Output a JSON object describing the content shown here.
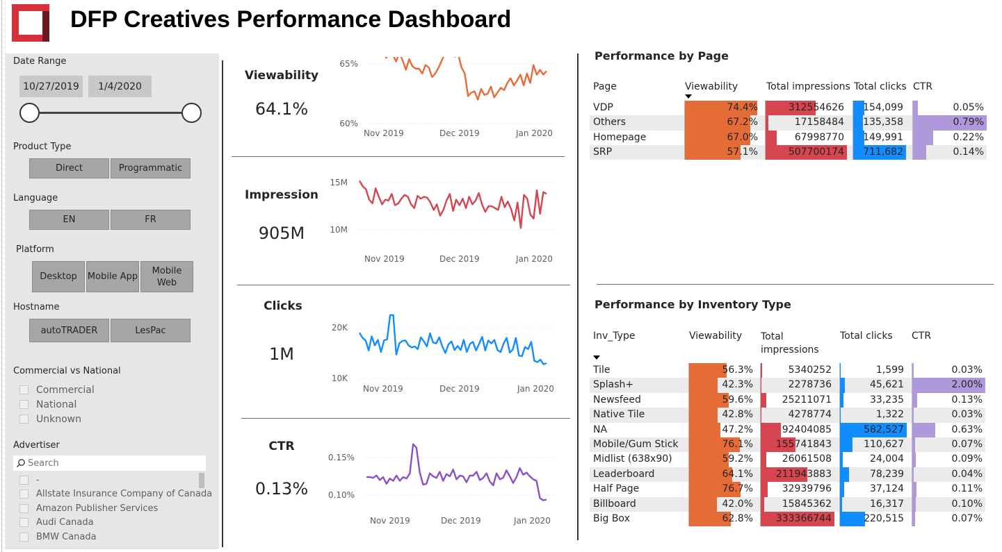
{
  "header": {
    "title": "DFP Creatives Performance Dashboard",
    "logo_icon": "logo-square-icon"
  },
  "colors": {
    "viewability": "#e66c37",
    "impressions": "#d64550",
    "clicks": "#118dff",
    "ctr": "#8a4fc7",
    "ctr_bar": "#b099db",
    "panel": "#e6e6e6",
    "button": "#a6a6a6"
  },
  "filters": {
    "date_range": {
      "label": "Date Range",
      "start": "10/27/2019",
      "end": "1/4/2020"
    },
    "product_type": {
      "label": "Product Type",
      "options": [
        "Direct",
        "Programmatic"
      ]
    },
    "language": {
      "label": "Language",
      "options": [
        "EN",
        "FR"
      ]
    },
    "platform": {
      "label": "Platform",
      "options": [
        "Desktop",
        "Mobile App",
        "Mobile Web"
      ]
    },
    "hostname": {
      "label": "Hostname",
      "options": [
        "autoTRADER",
        "LesPac"
      ]
    },
    "commercial_vs_national": {
      "label": "Commercial vs National",
      "options": [
        "Commercial",
        "National",
        "Unknown"
      ]
    },
    "advertiser": {
      "label": "Advertiser",
      "search_placeholder": "Search",
      "search_icon": "search-icon",
      "options": [
        "-",
        "Allstate Insurance Company of Canada",
        "Amazon Publisher Services",
        "Audi Canada",
        "BMW Canada"
      ]
    }
  },
  "kpis": [
    {
      "title": "Viewability",
      "value": "64.1%",
      "y_ticks": [
        "65%",
        "60%"
      ],
      "x_ticks": [
        "Nov 2019",
        "Dec 2019",
        "Jan 2020"
      ]
    },
    {
      "title": "Impression",
      "value": "905M",
      "y_ticks": [
        "15M",
        "10M"
      ],
      "x_ticks": [
        "Nov 2019",
        "Dec 2019",
        "Jan 2020"
      ]
    },
    {
      "title": "Clicks",
      "value": "1M",
      "y_ticks": [
        "20K",
        "10K"
      ],
      "x_ticks": [
        "Nov 2019",
        "Dec 2019",
        "Jan 2020"
      ]
    },
    {
      "title": "CTR",
      "value": "0.13%",
      "y_ticks": [
        "0.15%",
        "0.10%"
      ],
      "x_ticks": [
        "Nov 2019",
        "Dec 2019",
        "Jan 2020"
      ]
    }
  ],
  "chart_data": [
    {
      "type": "line",
      "x_ticks": [
        "Nov 2019",
        "Dec 2019",
        "Jan 2020"
      ],
      "y_ticks": [
        "60%",
        "65%"
      ],
      "ylim": [
        60,
        65
      ],
      "series": [
        {
          "values": [
            66.8,
            66.0,
            66.0,
            66.5,
            66.0,
            65.5,
            66.3,
            65.8,
            65.2,
            65.9,
            65.3,
            64.5,
            65.4,
            64.8,
            64.6,
            64.6,
            64.2,
            64.9,
            64.7,
            63.9,
            64.2,
            64.7,
            65.3,
            65.9,
            66.0,
            65.8,
            65.6,
            65.8,
            64.7,
            64.2,
            62.3,
            62.6,
            62.7,
            62.0,
            62.9,
            62.4,
            62.5,
            63.1,
            62.2,
            62.6,
            63.0,
            62.8,
            63.4,
            63.8,
            63.2,
            63.6,
            64.1,
            63.2,
            64.2,
            63.4,
            64.9,
            64.1,
            64.5,
            64.1,
            64.4
          ]
        }
      ]
    },
    {
      "type": "line",
      "x_ticks": [
        "Nov 2019",
        "Dec 2019",
        "Jan 2020"
      ],
      "y_ticks": [
        "10M",
        "15M"
      ],
      "ylim": [
        10,
        15
      ],
      "series": [
        {
          "values": [
            15.2,
            14.6,
            14.3,
            13.2,
            12.8,
            14.4,
            13.5,
            12.7,
            13.2,
            13.1,
            13.8,
            12.6,
            12.8,
            13.3,
            13.7,
            13.5,
            12.7,
            12.3,
            13.6,
            13.3,
            13.5,
            13.4,
            12.9,
            12.1,
            12.7,
            11.5,
            12.1,
            13.1,
            13.8,
            12.0,
            13.2,
            12.6,
            13.3,
            12.3,
            13.5,
            12.7,
            13.1,
            13.9,
            12.7,
            11.9,
            12.5,
            12.5,
            12.3,
            12.1,
            13.5,
            12.4,
            13.0,
            12.2,
            11.0,
            12.9,
            10.2,
            13.7,
            13.3,
            11.6,
            11.2,
            14.2,
            11.7,
            14.0,
            13.8
          ]
        }
      ]
    },
    {
      "type": "line",
      "x_ticks": [
        "Nov 2019",
        "Dec 2019",
        "Jan 2020"
      ],
      "y_ticks": [
        "10K",
        "20K"
      ],
      "ylim": [
        10,
        20
      ],
      "series": [
        {
          "values": [
            19.0,
            18.0,
            17.5,
            15.5,
            18.3,
            16.5,
            17.6,
            15.2,
            17.5,
            17.7,
            22.5,
            22.5,
            14.7,
            16.9,
            17.4,
            17.5,
            16.5,
            16.1,
            16.3,
            15.8,
            18.1,
            17.3,
            16.3,
            18.9,
            17.1,
            16.9,
            18.1,
            16.3,
            15.0,
            16.7,
            17.3,
            15.6,
            16.4,
            15.6,
            17.6,
            15.2,
            16.8,
            17.2,
            15.5,
            16.8,
            18.2,
            15.5,
            17.5,
            16.9,
            17.6,
            15.6,
            15.2,
            16.9,
            18.0,
            15.1,
            15.7,
            18.0,
            14.5,
            14.4,
            16.2,
            15.8,
            17.2,
            13.5,
            13.2,
            13.7,
            12.8,
            13.0
          ]
        }
      ]
    },
    {
      "type": "line",
      "x_ticks": [
        "Nov 2019",
        "Dec 2019",
        "Jan 2020"
      ],
      "y_ticks": [
        "0.10%",
        "0.15%"
      ],
      "ylim": [
        0.1,
        0.15
      ],
      "series": [
        {
          "values": [
            0.124,
            0.124,
            0.123,
            0.126,
            0.12,
            0.124,
            0.115,
            0.122,
            0.119,
            0.126,
            0.119,
            0.124,
            0.122,
            0.129,
            0.168,
            0.163,
            0.13,
            0.114,
            0.115,
            0.129,
            0.125,
            0.123,
            0.131,
            0.119,
            0.128,
            0.125,
            0.134,
            0.121,
            0.126,
            0.125,
            0.117,
            0.126,
            0.126,
            0.131,
            0.12,
            0.123,
            0.129,
            0.118,
            0.113,
            0.129,
            0.121,
            0.123,
            0.133,
            0.125,
            0.116,
            0.124,
            0.136,
            0.127,
            0.13,
            0.125,
            0.121,
            0.119,
            0.096,
            0.093,
            0.094
          ]
        }
      ]
    }
  ],
  "page_table": {
    "title": "Performance by Page",
    "headers": [
      "Page",
      "Viewability",
      "Total impressions",
      "Total clicks",
      "CTR"
    ],
    "rows": [
      {
        "name": "VDP",
        "viewability": "74.4%",
        "v": 74.4,
        "impressions": "312554626",
        "i": 312554626,
        "clicks": "154,099",
        "c": 154099,
        "ctr": "0.05%",
        "r": 0.05
      },
      {
        "name": "Others",
        "viewability": "67.2%",
        "v": 67.2,
        "impressions": "17158484",
        "i": 17158484,
        "clicks": "135,358",
        "c": 135358,
        "ctr": "0.79%",
        "r": 0.79
      },
      {
        "name": "Homepage",
        "viewability": "67.0%",
        "v": 67.0,
        "impressions": "67998770",
        "i": 67998770,
        "clicks": "149,991",
        "c": 149991,
        "ctr": "0.22%",
        "r": 0.22
      },
      {
        "name": "SRP",
        "viewability": "57.1%",
        "v": 57.1,
        "impressions": "507700174",
        "i": 507700174,
        "clicks": "711,682",
        "c": 711682,
        "ctr": "0.14%",
        "r": 0.14
      }
    ]
  },
  "inventory_table": {
    "title": "Performance by Inventory Type",
    "headers": [
      "Inv_Type",
      "Viewability",
      "Total impressions",
      "Total clicks",
      "CTR"
    ],
    "rows": [
      {
        "name": "Tile",
        "viewability": "56.3%",
        "v": 56.3,
        "impressions": "5340252",
        "i": 5340252,
        "clicks": "1,599",
        "c": 1599,
        "ctr": "0.03%",
        "r": 0.03
      },
      {
        "name": "Splash+",
        "viewability": "42.3%",
        "v": 42.3,
        "impressions": "2278736",
        "i": 2278736,
        "clicks": "45,621",
        "c": 45621,
        "ctr": "2.00%",
        "r": 2.0
      },
      {
        "name": "Newsfeed",
        "viewability": "59.6%",
        "v": 59.6,
        "impressions": "25211071",
        "i": 25211071,
        "clicks": "33,235",
        "c": 33235,
        "ctr": "0.13%",
        "r": 0.13
      },
      {
        "name": "Native Tile",
        "viewability": "42.8%",
        "v": 42.8,
        "impressions": "4278774",
        "i": 4278774,
        "clicks": "1,322",
        "c": 1322,
        "ctr": "0.03%",
        "r": 0.03
      },
      {
        "name": "NA",
        "viewability": "47.2%",
        "v": 47.2,
        "impressions": "92404085",
        "i": 92404085,
        "clicks": "582,527",
        "c": 582527,
        "ctr": "0.63%",
        "r": 0.63
      },
      {
        "name": "Mobile/Gum Stick",
        "viewability": "76.1%",
        "v": 76.1,
        "impressions": "155741843",
        "i": 155741843,
        "clicks": "110,627",
        "c": 110627,
        "ctr": "0.07%",
        "r": 0.07
      },
      {
        "name": "Midlist (638x90)",
        "viewability": "59.2%",
        "v": 59.2,
        "impressions": "26061508",
        "i": 26061508,
        "clicks": "24,004",
        "c": 24004,
        "ctr": "0.09%",
        "r": 0.09
      },
      {
        "name": "Leaderboard",
        "viewability": "64.1%",
        "v": 64.1,
        "impressions": "211943883",
        "i": 211943883,
        "clicks": "78,239",
        "c": 78239,
        "ctr": "0.04%",
        "r": 0.04
      },
      {
        "name": "Half Page",
        "viewability": "76.7%",
        "v": 76.7,
        "impressions": "32939796",
        "i": 32939796,
        "clicks": "37,124",
        "c": 37124,
        "ctr": "0.11%",
        "r": 0.11
      },
      {
        "name": "Billboard",
        "viewability": "42.0%",
        "v": 42.0,
        "impressions": "15845362",
        "i": 15845362,
        "clicks": "16,317",
        "c": 16317,
        "ctr": "0.10%",
        "r": 0.1
      },
      {
        "name": "Big Box",
        "viewability": "62.8%",
        "v": 62.8,
        "impressions": "333366744",
        "i": 333366744,
        "clicks": "220,515",
        "c": 220515,
        "ctr": "0.07%",
        "r": 0.07
      }
    ]
  }
}
